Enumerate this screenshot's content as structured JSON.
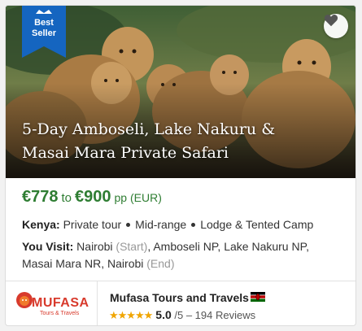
{
  "badge": {
    "line1": "Best",
    "line2": "Seller"
  },
  "tour": {
    "title_line1": "5-Day Amboseli, Lake Nakuru &",
    "title_line2": "Masai Mara Private Safari"
  },
  "price": {
    "from": "€778",
    "to_word": "to",
    "to": "€900",
    "unit": "pp (EUR)"
  },
  "details": {
    "country_label": "Kenya:",
    "tags": [
      "Private tour",
      "Mid-range",
      "Lodge & Tented Camp"
    ]
  },
  "visit": {
    "label": "You Visit:",
    "line1_a": "Nairobi",
    "line1_b": "(Start)",
    "line1_c": ", Amboseli NP, Lake Nakuru NP,",
    "line2_a": "Masai Mara NR, Nairobi",
    "line2_b": "(End)"
  },
  "operator": {
    "logo_word": "MUFASA",
    "logo_sub": "Tours & Travels",
    "name": "Mufasa Tours and Travels",
    "flag_icon": "kenya-flag-icon",
    "stars": "★★★★★",
    "rating": "5.0",
    "rating_max": "/5",
    "reviews": "– 194 Reviews"
  },
  "colors": {
    "price_green": "#2e7d32",
    "badge_blue": "#1565c0",
    "star": "#f0a500",
    "logo_red": "#d83a2c"
  }
}
